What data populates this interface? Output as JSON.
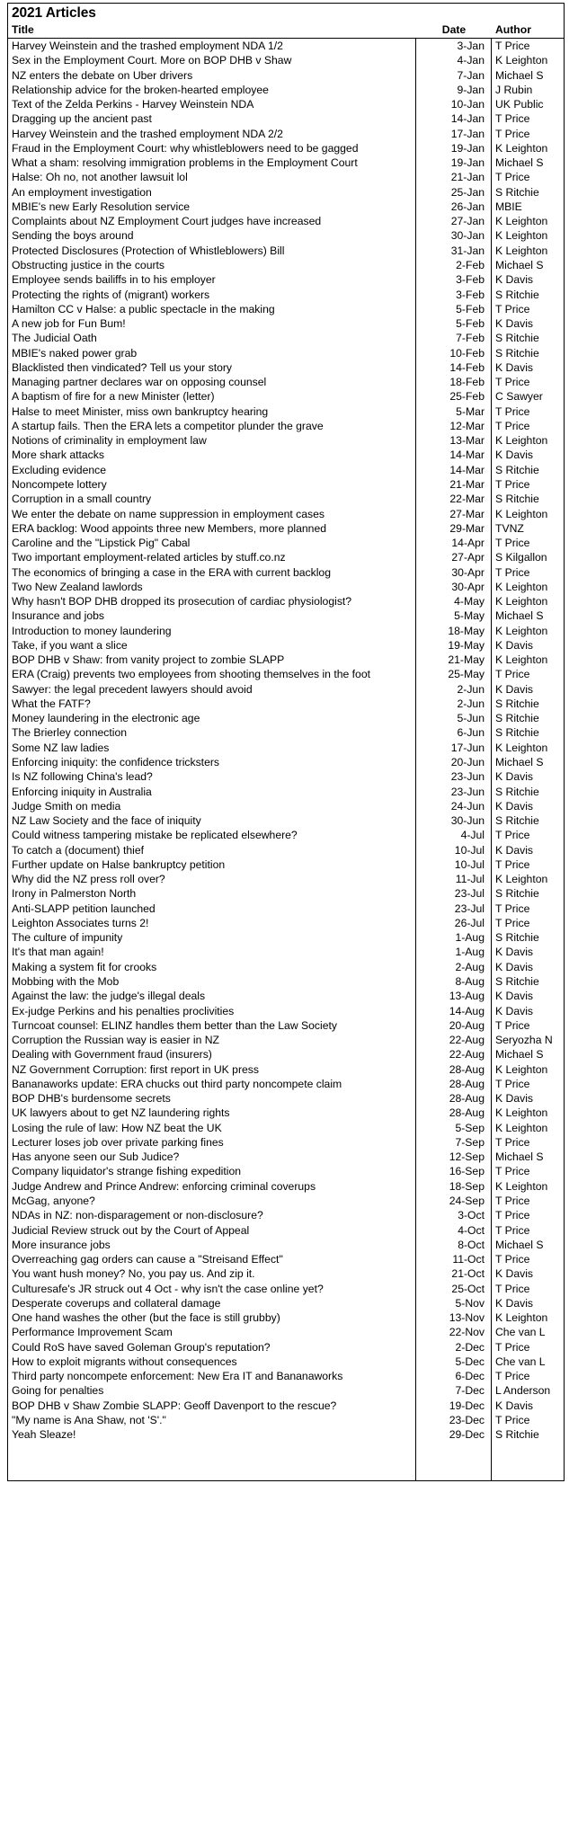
{
  "sheet": {
    "title": "2021 Articles",
    "columns": {
      "title": "Title",
      "date": "Date",
      "author": "Author"
    },
    "colors": {
      "text": "#000000",
      "border": "#000000",
      "background": "#ffffff"
    }
  },
  "rows": [
    {
      "title": "Harvey Weinstein and the trashed employment NDA 1/2",
      "date": "3-Jan",
      "author": "T Price"
    },
    {
      "title": "Sex in the Employment Court. More on BOP DHB v Shaw",
      "date": "4-Jan",
      "author": "K Leighton"
    },
    {
      "title": "NZ enters the debate on Uber drivers",
      "date": "7-Jan",
      "author": "Michael S"
    },
    {
      "title": "Relationship advice for the broken-hearted employee",
      "date": "9-Jan",
      "author": "J Rubin"
    },
    {
      "title": "Text of the Zelda Perkins - Harvey Weinstein NDA",
      "date": "10-Jan",
      "author": "UK Public"
    },
    {
      "title": "Dragging up the ancient past",
      "date": "14-Jan",
      "author": "T Price"
    },
    {
      "title": "Harvey Weinstein and the trashed employment NDA 2/2",
      "date": "17-Jan",
      "author": "T Price"
    },
    {
      "title": "Fraud in the Employment Court: why whistleblowers need to be gagged",
      "date": "19-Jan",
      "author": "K Leighton"
    },
    {
      "title": "What a sham: resolving immigration problems in the Employment Court",
      "date": "19-Jan",
      "author": "Michael S"
    },
    {
      "title": "Halse: Oh no, not another lawsuit lol",
      "date": "21-Jan",
      "author": "T Price"
    },
    {
      "title": "An employment investigation",
      "date": "25-Jan",
      "author": "S Ritchie"
    },
    {
      "title": "MBIE's new Early Resolution service",
      "date": "26-Jan",
      "author": "MBIE"
    },
    {
      "title": "Complaints about NZ Employment Court judges have increased",
      "date": "27-Jan",
      "author": "K Leighton"
    },
    {
      "title": "Sending the boys around",
      "date": "30-Jan",
      "author": "K Leighton"
    },
    {
      "title": "Protected Disclosures (Protection of Whistleblowers) Bill",
      "date": "31-Jan",
      "author": "K Leighton"
    },
    {
      "title": "Obstructing justice in the courts",
      "date": "2-Feb",
      "author": "Michael S"
    },
    {
      "title": "Employee sends bailiffs in to his employer",
      "date": "3-Feb",
      "author": "K Davis"
    },
    {
      "title": "Protecting the rights of (migrant) workers",
      "date": "3-Feb",
      "author": "S Ritchie"
    },
    {
      "title": "Hamilton CC v Halse: a public spectacle in the making",
      "date": "5-Feb",
      "author": "T Price"
    },
    {
      "title": "A new job for Fun Bum!",
      "date": "5-Feb",
      "author": "K Davis"
    },
    {
      "title": "The Judicial Oath",
      "date": "7-Feb",
      "author": "S Ritchie"
    },
    {
      "title": "MBIE's naked power grab",
      "date": "10-Feb",
      "author": "S Ritchie"
    },
    {
      "title": "Blacklisted then vindicated? Tell us your story",
      "date": "14-Feb",
      "author": "K Davis"
    },
    {
      "title": "Managing partner declares war on opposing counsel",
      "date": "18-Feb",
      "author": "T Price"
    },
    {
      "title": "A baptism of fire for a new Minister (letter)",
      "date": "25-Feb",
      "author": "C Sawyer"
    },
    {
      "title": "Halse to meet Minister, miss own bankruptcy hearing",
      "date": "5-Mar",
      "author": "T Price"
    },
    {
      "title": "A startup fails. Then the ERA lets a competitor plunder the grave",
      "date": "12-Mar",
      "author": "T Price"
    },
    {
      "title": "Notions of criminality in employment law",
      "date": "13-Mar",
      "author": "K Leighton"
    },
    {
      "title": "More shark attacks",
      "date": "14-Mar",
      "author": "K Davis"
    },
    {
      "title": "Excluding evidence",
      "date": "14-Mar",
      "author": "S Ritchie"
    },
    {
      "title": "Noncompete lottery",
      "date": "21-Mar",
      "author": "T Price"
    },
    {
      "title": "Corruption in a small country",
      "date": "22-Mar",
      "author": "S Ritchie"
    },
    {
      "title": "We enter the debate on name suppression in employment cases",
      "date": "27-Mar",
      "author": "K Leighton"
    },
    {
      "title": "ERA backlog: Wood appoints three new Members, more planned",
      "date": "29-Mar",
      "author": "TVNZ"
    },
    {
      "title": "Caroline and the \"Lipstick Pig\" Cabal",
      "date": "14-Apr",
      "author": "T Price"
    },
    {
      "title": "Two important employment-related articles by stuff.co.nz",
      "date": "27-Apr",
      "author": "S Kilgallon"
    },
    {
      "title": "The economics of bringing a case in the ERA with current backlog",
      "date": "30-Apr",
      "author": "T Price"
    },
    {
      "title": "Two New Zealand lawlords",
      "date": "30-Apr",
      "author": "K Leighton"
    },
    {
      "title": "Why hasn't BOP DHB dropped its prosecution of cardiac physiologist?",
      "date": "4-May",
      "author": "K Leighton"
    },
    {
      "title": "Insurance and jobs",
      "date": "5-May",
      "author": "Michael S"
    },
    {
      "title": "Introduction to money laundering",
      "date": "18-May",
      "author": "K Leighton"
    },
    {
      "title": "Take, if you want a slice",
      "date": "19-May",
      "author": "K Davis"
    },
    {
      "title": "BOP DHB v Shaw: from vanity project to zombie SLAPP",
      "date": "21-May",
      "author": "K Leighton"
    },
    {
      "title": "ERA (Craig) prevents two employees from shooting themselves in the foot",
      "date": "25-May",
      "author": "T Price"
    },
    {
      "title": "Sawyer: the legal precedent lawyers should avoid",
      "date": "2-Jun",
      "author": "K Davis"
    },
    {
      "title": "What the FATF?",
      "date": "2-Jun",
      "author": "S Ritchie"
    },
    {
      "title": "Money laundering in the electronic age",
      "date": "5-Jun",
      "author": "S Ritchie"
    },
    {
      "title": "The Brierley connection",
      "date": "6-Jun",
      "author": "S Ritchie"
    },
    {
      "title": "Some NZ law ladies",
      "date": "17-Jun",
      "author": "K Leighton"
    },
    {
      "title": "Enforcing iniquity: the confidence tricksters",
      "date": "20-Jun",
      "author": "Michael S"
    },
    {
      "title": "Is NZ following China's lead?",
      "date": "23-Jun",
      "author": "K Davis"
    },
    {
      "title": "Enforcing iniquity in Australia",
      "date": "23-Jun",
      "author": "S Ritchie"
    },
    {
      "title": "Judge Smith on media",
      "date": "24-Jun",
      "author": "K Davis"
    },
    {
      "title": "NZ Law Society and the face of iniquity",
      "date": "30-Jun",
      "author": "S Ritchie"
    },
    {
      "title": "Could witness tampering mistake be replicated elsewhere?",
      "date": "4-Jul",
      "author": "T Price"
    },
    {
      "title": "To catch a (document) thief",
      "date": "10-Jul",
      "author": "K Davis"
    },
    {
      "title": "Further update on Halse bankruptcy petition",
      "date": "10-Jul",
      "author": "T Price"
    },
    {
      "title": "Why did the NZ press roll over?",
      "date": "11-Jul",
      "author": "K Leighton"
    },
    {
      "title": "Irony in Palmerston North",
      "date": "23-Jul",
      "author": "S Ritchie"
    },
    {
      "title": "Anti-SLAPP petition launched",
      "date": "23-Jul",
      "author": "T Price"
    },
    {
      "title": "Leighton Associates turns 2!",
      "date": "26-Jul",
      "author": "T Price"
    },
    {
      "title": "The culture of impunity",
      "date": "1-Aug",
      "author": "S Ritchie"
    },
    {
      "title": "It's that man again!",
      "date": "1-Aug",
      "author": "K Davis"
    },
    {
      "title": "Making a system fit for crooks",
      "date": "2-Aug",
      "author": "K Davis"
    },
    {
      "title": "Mobbing with the Mob",
      "date": "8-Aug",
      "author": "S Ritchie"
    },
    {
      "title": "Against the law: the judge's illegal deals",
      "date": "13-Aug",
      "author": "K Davis"
    },
    {
      "title": "Ex-judge Perkins and his penalties proclivities",
      "date": "14-Aug",
      "author": "K Davis"
    },
    {
      "title": "Turncoat counsel: ELINZ handles them better than the Law Society",
      "date": "20-Aug",
      "author": "T Price"
    },
    {
      "title": "Corruption the Russian way is easier in NZ",
      "date": "22-Aug",
      "author": "Seryozha N"
    },
    {
      "title": "Dealing with Government fraud (insurers)",
      "date": "22-Aug",
      "author": "Michael S"
    },
    {
      "title": "NZ Government Corruption: first report in UK press",
      "date": "28-Aug",
      "author": "K Leighton"
    },
    {
      "title": "Bananaworks update: ERA chucks out third party noncompete claim",
      "date": "28-Aug",
      "author": "T Price"
    },
    {
      "title": "BOP DHB's burdensome secrets",
      "date": "28-Aug",
      "author": "K Davis"
    },
    {
      "title": "UK lawyers about to get NZ laundering rights",
      "date": "28-Aug",
      "author": "K Leighton"
    },
    {
      "title": "Losing the rule of law: How NZ beat the UK",
      "date": "5-Sep",
      "author": "K Leighton"
    },
    {
      "title": "Lecturer loses job over private parking fines",
      "date": "7-Sep",
      "author": "T Price"
    },
    {
      "title": "Has anyone seen our Sub Judice?",
      "date": "12-Sep",
      "author": "Michael S"
    },
    {
      "title": "Company liquidator's strange fishing expedition",
      "date": "16-Sep",
      "author": "T Price"
    },
    {
      "title": "Judge Andrew and Prince Andrew: enforcing criminal coverups",
      "date": "18-Sep",
      "author": "K Leighton"
    },
    {
      "title": "McGag, anyone?",
      "date": "24-Sep",
      "author": "T Price"
    },
    {
      "title": "NDAs in NZ: non-disparagement or non-disclosure?",
      "date": "3-Oct",
      "author": "T Price"
    },
    {
      "title": "Judicial Review struck out by the Court of Appeal",
      "date": "4-Oct",
      "author": "T Price"
    },
    {
      "title": "More insurance jobs",
      "date": "8-Oct",
      "author": "Michael S"
    },
    {
      "title": "Overreaching gag orders can cause a \"Streisand Effect\"",
      "date": "11-Oct",
      "author": "T Price"
    },
    {
      "title": "You want hush money? No, you pay us. And zip it.",
      "date": "21-Oct",
      "author": "K Davis"
    },
    {
      "title": "Culturesafe's JR struck out 4 Oct - why isn't the case online yet?",
      "date": "25-Oct",
      "author": "T Price"
    },
    {
      "title": "Desperate coverups and collateral damage",
      "date": "5-Nov",
      "author": "K Davis"
    },
    {
      "title": "One hand washes the other (but the face is still grubby)",
      "date": "13-Nov",
      "author": "K Leighton"
    },
    {
      "title": "Performance Improvement Scam",
      "date": "22-Nov",
      "author": "Che van L"
    },
    {
      "title": "Could RoS have saved Goleman Group's reputation?",
      "date": "2-Dec",
      "author": "T Price"
    },
    {
      "title": "How to exploit migrants without consequences",
      "date": "5-Dec",
      "author": "Che van L"
    },
    {
      "title": "Third party noncompete enforcement: New Era IT and Bananaworks",
      "date": "6-Dec",
      "author": "T Price"
    },
    {
      "title": "Going for penalties",
      "date": "7-Dec",
      "author": "L Anderson"
    },
    {
      "title": "BOP DHB v Shaw Zombie SLAPP: Geoff Davenport to the rescue?",
      "date": "19-Dec",
      "author": "K Davis"
    },
    {
      "title": "\"My name is Ana Shaw, not 'S'.\"",
      "date": "23-Dec",
      "author": "T Price"
    },
    {
      "title": "Yeah Sleaze!",
      "date": "29-Dec",
      "author": "S Ritchie"
    }
  ]
}
